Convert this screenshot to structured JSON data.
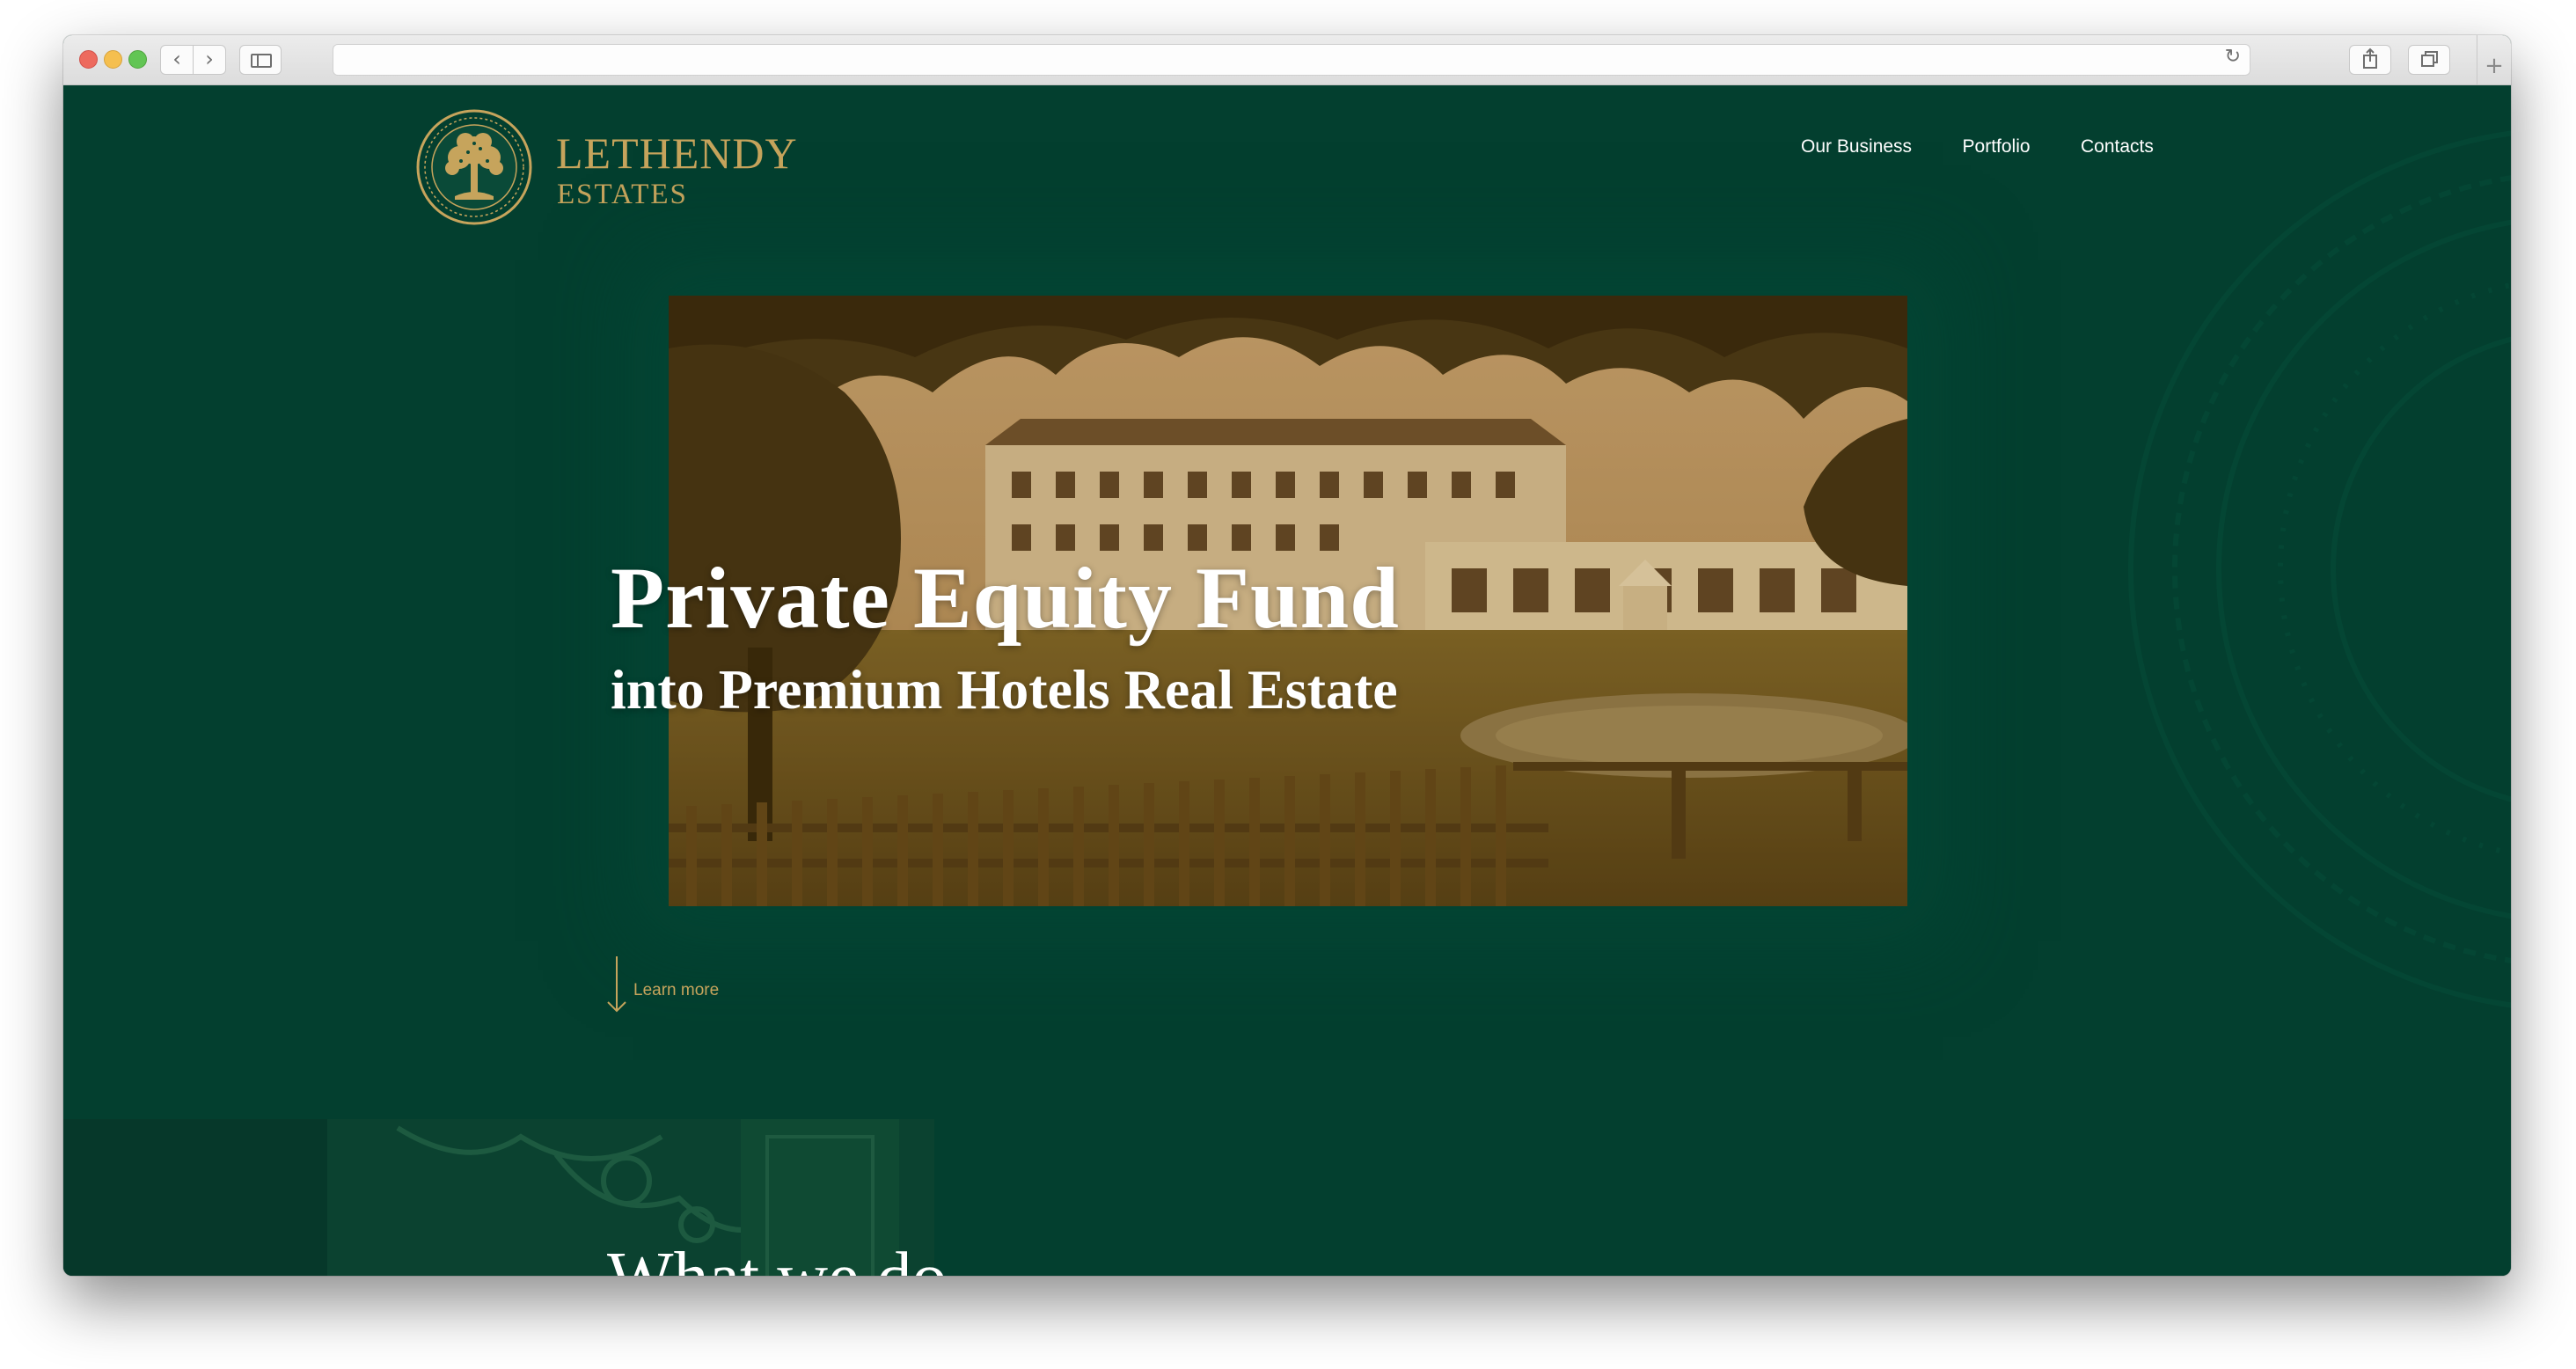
{
  "browser": {
    "icons": {
      "back": "chevron-left-icon",
      "forward": "chevron-right-icon",
      "sidebar": "sidebar-icon",
      "reload": "reload-icon",
      "share": "share-icon",
      "tabs": "tabs-icon",
      "new_tab": "plus-icon"
    },
    "url": ""
  },
  "brand": {
    "name": "LETHENDY",
    "subtitle": "ESTATES",
    "accent_color": "#c6a45c",
    "background_color": "#033f2f"
  },
  "nav": {
    "items": [
      {
        "label": "Our Business"
      },
      {
        "label": "Portfolio"
      },
      {
        "label": "Contacts"
      }
    ]
  },
  "hero": {
    "title": "Private Equity Fund",
    "subtitle": "into Premium Hotels Real Estate",
    "learn_more": "Learn more"
  },
  "section": {
    "title": "What we do"
  }
}
